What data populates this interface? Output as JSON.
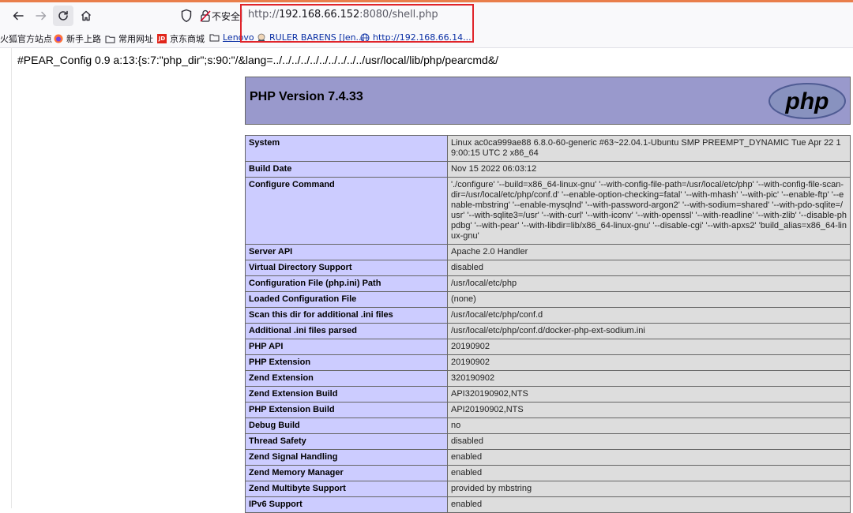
{
  "browser": {
    "security_label": "不安全",
    "url_prefix": "http://",
    "url_host": "192.168.66.152",
    "url_rest": ":8080/shell.php",
    "bookmarks": [
      {
        "label": "火狐官方站点"
      },
      {
        "label": "新手上路"
      },
      {
        "label": "常用网址"
      },
      {
        "label": "京东商城"
      },
      {
        "label": "Lenovo"
      },
      {
        "label": "RULER BARENS [Jen..."
      },
      {
        "label": "http://192.168.66.14..."
      }
    ]
  },
  "page": {
    "pear_line": "#PEAR_Config 0.9 a:13:{s:7:\"php_dir\";s:90:\"/&lang=../../../../../../../../../../usr/local/lib/php/pearcmd&/",
    "php_version": "PHP Version 7.4.33",
    "logo_text": "php",
    "rows": [
      {
        "key": "System",
        "value": "Linux ac0ca999ae88 6.8.0-60-generic #63~22.04.1-Ubuntu SMP PREEMPT_DYNAMIC Tue Apr 22 19:00:15 UTC 2 x86_64"
      },
      {
        "key": "Build Date",
        "value": "Nov 15 2022 06:03:12"
      },
      {
        "key": "Configure Command",
        "value": "'./configure' '--build=x86_64-linux-gnu' '--with-config-file-path=/usr/local/etc/php' '--with-config-file-scan-dir=/usr/local/etc/php/conf.d' '--enable-option-checking=fatal' '--with-mhash' '--with-pic' '--enable-ftp' '--enable-mbstring' '--enable-mysqlnd' '--with-password-argon2' '--with-sodium=shared' '--with-pdo-sqlite=/usr' '--with-sqlite3=/usr' '--with-curl' '--with-iconv' '--with-openssl' '--with-readline' '--with-zlib' '--disable-phpdbg' '--with-pear' '--with-libdir=lib/x86_64-linux-gnu' '--disable-cgi' '--with-apxs2' 'build_alias=x86_64-linux-gnu'"
      },
      {
        "key": "Server API",
        "value": "Apache 2.0 Handler"
      },
      {
        "key": "Virtual Directory Support",
        "value": "disabled"
      },
      {
        "key": "Configuration File (php.ini) Path",
        "value": "/usr/local/etc/php"
      },
      {
        "key": "Loaded Configuration File",
        "value": "(none)"
      },
      {
        "key": "Scan this dir for additional .ini files",
        "value": "/usr/local/etc/php/conf.d"
      },
      {
        "key": "Additional .ini files parsed",
        "value": "/usr/local/etc/php/conf.d/docker-php-ext-sodium.ini"
      },
      {
        "key": "PHP API",
        "value": "20190902"
      },
      {
        "key": "PHP Extension",
        "value": "20190902"
      },
      {
        "key": "Zend Extension",
        "value": "320190902"
      },
      {
        "key": "Zend Extension Build",
        "value": "API320190902,NTS"
      },
      {
        "key": "PHP Extension Build",
        "value": "API20190902,NTS"
      },
      {
        "key": "Debug Build",
        "value": "no"
      },
      {
        "key": "Thread Safety",
        "value": "disabled"
      },
      {
        "key": "Zend Signal Handling",
        "value": "enabled"
      },
      {
        "key": "Zend Memory Manager",
        "value": "enabled"
      },
      {
        "key": "Zend Multibyte Support",
        "value": "provided by mbstring"
      },
      {
        "key": "IPv6 Support",
        "value": "enabled"
      }
    ]
  }
}
